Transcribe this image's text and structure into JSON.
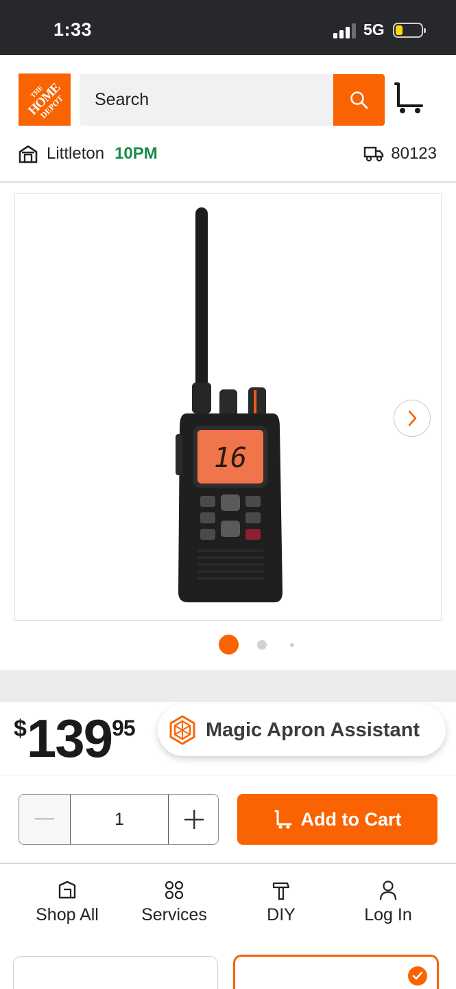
{
  "status_bar": {
    "time": "1:33",
    "network": "5G",
    "battery_level": 0.25,
    "battery_color": "#ffd60a"
  },
  "header": {
    "logo": {
      "line1": "THE",
      "line2": "HOME",
      "line3": "DEPOT",
      "color": "#f96302"
    },
    "search": {
      "placeholder": "Search"
    },
    "store": {
      "name": "Littleton",
      "hours": "10PM",
      "hours_color": "#168c4a"
    },
    "delivery": {
      "zip": "80123"
    }
  },
  "gallery": {
    "image_alt": "handheld-marine-radio",
    "screen_text": "16",
    "slide_count": 3,
    "active_slide": 1
  },
  "price": {
    "currency": "$",
    "dollars": "139",
    "cents": "95"
  },
  "assistant": {
    "label": "Magic Apron Assistant"
  },
  "cart": {
    "quantity": "1",
    "add_label": "Add to Cart",
    "accent": "#f96302"
  },
  "nav": {
    "items": [
      {
        "label": "Shop All",
        "icon": "store-tag-icon"
      },
      {
        "label": "Services",
        "icon": "grid-dots-icon"
      },
      {
        "label": "DIY",
        "icon": "hammer-icon"
      },
      {
        "label": "Log In",
        "icon": "person-icon"
      }
    ]
  }
}
